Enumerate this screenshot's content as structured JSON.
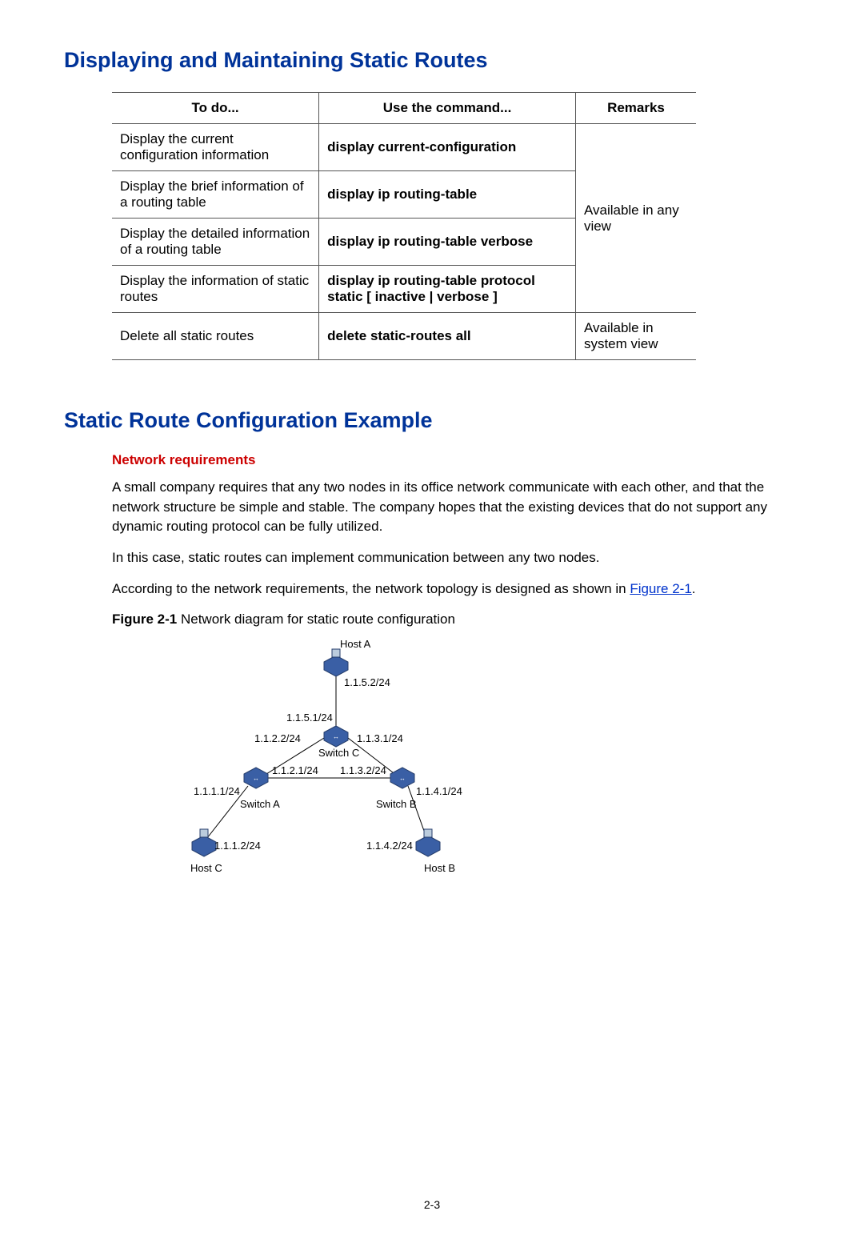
{
  "heading1": "Displaying and Maintaining Static Routes",
  "table": {
    "headers": {
      "todo": "To do...",
      "cmd": "Use the command...",
      "remarks": "Remarks"
    },
    "rows": [
      {
        "todo": "Display the current configuration information",
        "cmd": "display current-configuration"
      },
      {
        "todo": "Display the brief information of a routing table",
        "cmd": "display ip routing-table"
      },
      {
        "todo": "Display the detailed information of a routing table",
        "cmd": "display ip routing-table verbose"
      },
      {
        "todo": "Display the information of static routes",
        "cmd": "display ip routing-table protocol static [ inactive | verbose ]"
      },
      {
        "todo": "Delete all static routes",
        "cmd": "delete static-routes all"
      }
    ],
    "remarks": {
      "any_view": "Available in any view",
      "system_view": "Available in system view"
    }
  },
  "heading2": "Static Route Configuration Example",
  "subheading": "Network requirements",
  "para1": "A small company requires that any two nodes in its office network communicate with each other, and that the network structure be simple and stable. The company hopes that the existing devices that do not support any dynamic routing protocol can be fully utilized.",
  "para2": "In this case, static routes can implement communication between any two nodes.",
  "para3_prefix": "According to the network requirements, the network topology is designed as shown in ",
  "figure_link": "Figure 2-1",
  "para3_suffix": ".",
  "figure_caption_bold": "Figure 2-1",
  "figure_caption_rest": " Network diagram for static route configuration",
  "diagram": {
    "hostA": "Host A",
    "hostB": "Host B",
    "hostC": "Host C",
    "switchA": "Switch A",
    "switchB": "Switch B",
    "switchC": "Switch C",
    "ip_1_1_5_2": "1.1.5.2/24",
    "ip_1_1_5_1": "1.1.5.1/24",
    "ip_1_1_2_2": "1.1.2.2/24",
    "ip_1_1_3_1": "1.1.3.1/24",
    "ip_1_1_2_1": "1.1.2.1/24",
    "ip_1_1_3_2": "1.1.3.2/24",
    "ip_1_1_1_1": "1.1.1.1/24",
    "ip_1_1_4_1": "1.1.4.1/24",
    "ip_1_1_1_2": "1.1.1.2/24",
    "ip_1_1_4_2": "1.1.4.2/24"
  },
  "page_number": "2-3"
}
